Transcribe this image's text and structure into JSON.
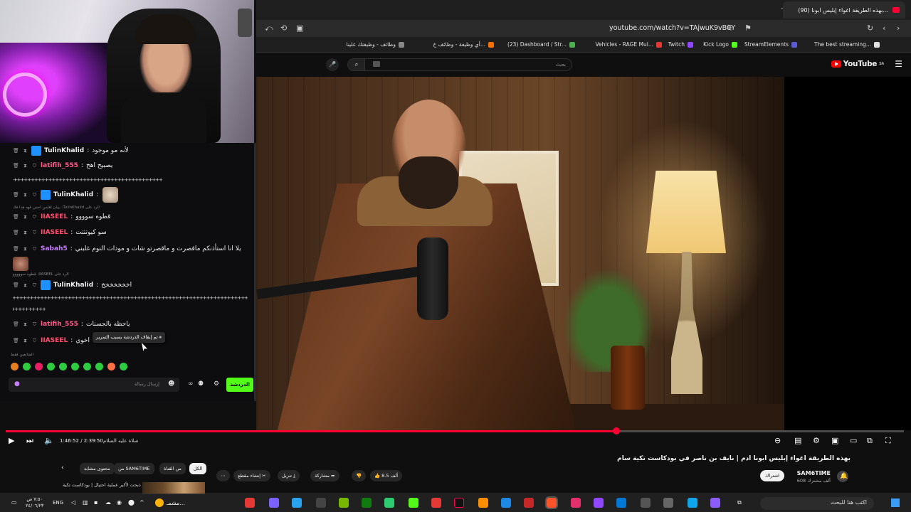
{
  "browser": {
    "tab_title": "(90) بهذه الطريقة اغواء إبليس ابونا...",
    "url": "youtube.com/watch?v=TAjwuK9vB0Y",
    "bookmarks": [
      {
        "label": "The best streaming...",
        "color": "#e0e0e0"
      },
      {
        "label": "StreamElements",
        "color": "#5b5bd6"
      },
      {
        "label": "Kick Logo",
        "color": "#53fc18"
      },
      {
        "label": "Twitch",
        "color": "#9146ff"
      },
      {
        "label": "Vehicles - RAGE Mul...",
        "color": "#e53935"
      },
      {
        "label": "(23) Dashboard / Str...",
        "color": "#4caf50"
      },
      {
        "label": "أي وظيفة - وظائف خ...",
        "color": "#ff6f00"
      },
      {
        "label": "وظائف - وظيفتك علينا",
        "color": "#888888"
      }
    ]
  },
  "youtube": {
    "logo": "YouTube",
    "logo_region": "SA",
    "search_placeholder": "بحث"
  },
  "player": {
    "time": "1:46:52 / 2:39:50",
    "chapter": "صلاة عليه السلام",
    "progress": 0.68
  },
  "video": {
    "title": "بهذه الطريقة اغواء إبليس ابونا ادم | نايف بن ناصر في بودكاست تكية سام",
    "channel": "SAM6TIME",
    "subs": "608 ألف مشترك",
    "subscribe": "اشتراك",
    "likes": "8.5 ألف",
    "share": "مشاركة",
    "download": "تنزيل",
    "clip": "إنشاء مقطع",
    "chips": [
      "الكل",
      "من القناة",
      "من SAM6TIME",
      "محتوى مشابه"
    ],
    "rec_title": "ذبحت لأكبر عملية احتيال | بودكاست تكية"
  },
  "chat": {
    "messages": [
      {
        "user": "TulinKhalid",
        "color": "#ffffff",
        "text": "لأنه مو موجود"
      },
      {
        "user": "latifih_555",
        "color": "#ff5c8a",
        "text": "يصبيح اهخ"
      },
      {
        "user": "TulinKhalid",
        "color": "#ffffff",
        "text": ""
      },
      {
        "user": "IIASEEL",
        "color": "#ff4d6d",
        "text": "قطوه سوووو"
      },
      {
        "user": "IIASEEL",
        "color": "#ff4d6d",
        "text": "سو كيوتتتت"
      },
      {
        "user": "Sabah5",
        "color": "#c77dff",
        "text": "يلا انا استأذنكم ماقصرت و ماقصرتو شات و مودات النوم غلبني"
      },
      {
        "user": "TulinKhalid",
        "color": "#ffffff",
        "text": "اخخخخخخخ"
      },
      {
        "user": "latifih_555",
        "color": "#ff5c8a",
        "text": "ياحظه بالحسنات"
      },
      {
        "user": "IIASEEL",
        "color": "#ff4d6d",
        "text": "اخوي"
      }
    ],
    "reply1": "الرد على TulinKhalid: بيبان افلس احس قهه هذا فك",
    "reply2": "الرد على IIASEEL: قطوه سووووو",
    "spam1": "++++++++++++++++++++++++++++++++++++++++++++++++++++++++++",
    "spam2": "+++++++++++++++++++++++++++++++++++++++++++++++++++++++++++++++++++++++++++",
    "spam3": "+++++++++++",
    "tooltip": "تم إيقاف الدردشة بسبب التمرير",
    "role_tag": "المتابعين فقط",
    "input_placeholder": "إرسال رسالة",
    "send": "الدردشة"
  },
  "taskbar": {
    "time": "٧:٥٠ ص",
    "date": "٢٤/٠٦/٢٣",
    "lang": "ENG",
    "weather": "مشمـ...",
    "search": "اكتب هنا للبحث"
  }
}
